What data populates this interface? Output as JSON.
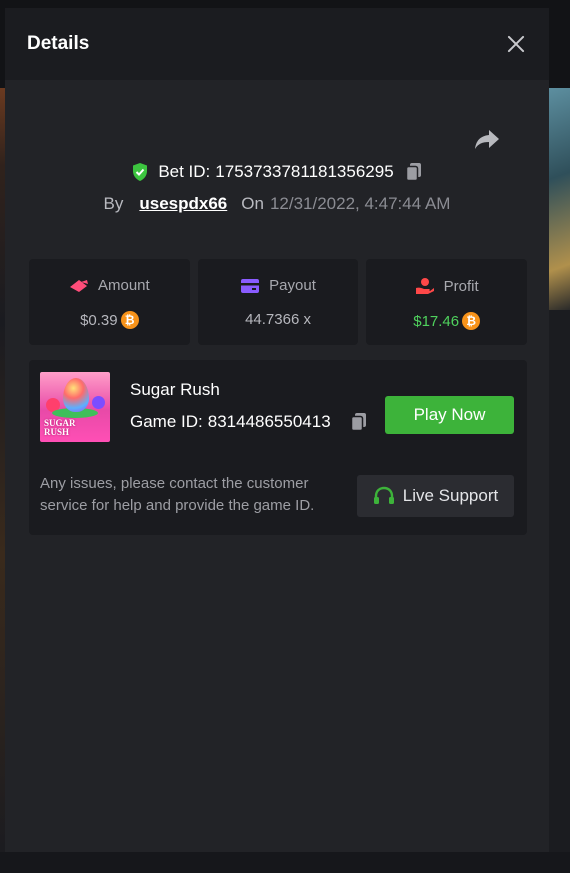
{
  "modal": {
    "title": "Details"
  },
  "bet": {
    "id_label": "Bet ID:",
    "id_value": "1753733781181356295",
    "by_label": "By",
    "username": "usespdx66",
    "on_label": "On",
    "datetime": "12/31/2022, 4:47:44 AM"
  },
  "stats": {
    "amount": {
      "label": "Amount",
      "value": "$0.39",
      "icon": "amount-icon",
      "color": "#ff4d7a"
    },
    "payout": {
      "label": "Payout",
      "value": "44.7366 x",
      "icon": "card-icon",
      "color": "#8a5cff"
    },
    "profit": {
      "label": "Profit",
      "value": "$17.46",
      "icon": "hand-icon",
      "color": "#ff4848",
      "value_color": "#4fd15d"
    },
    "coin": {
      "symbol": "₿",
      "icon": "bitcoin-icon",
      "color": "#f7931a"
    }
  },
  "game": {
    "name": "Sugar Rush",
    "id_label": "Game ID:",
    "id_value": "8314486550413",
    "thumb_line1": "SUGAR",
    "thumb_line2": "RUSH",
    "play_label": "Play Now",
    "play_color": "#3db33a"
  },
  "support": {
    "text": "Any issues, please contact the customer service for help and provide the game ID.",
    "button_label": "Live Support",
    "icon": "headset-icon"
  }
}
